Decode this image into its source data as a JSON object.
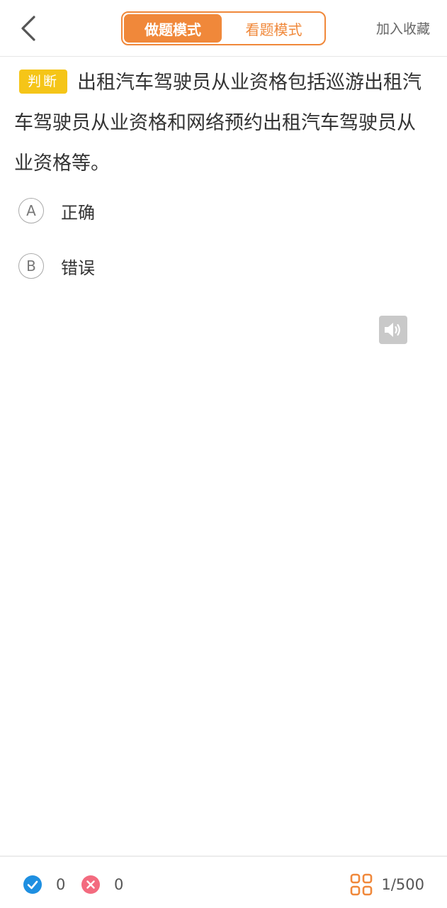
{
  "header": {
    "back_icon": "chevron-left-icon",
    "modes": [
      {
        "label": "做题模式",
        "active": true
      },
      {
        "label": "看题模式",
        "active": false
      }
    ],
    "favorite_label": "加入收藏"
  },
  "question": {
    "type_badge": "判断",
    "text": "出租汽车驾驶员从业资格包括巡游出租汽车驾驶员从业资格和网络预约出租汽车驾驶员从业资格等。",
    "options": [
      {
        "letter": "A",
        "text": "正确"
      },
      {
        "letter": "B",
        "text": "错误"
      }
    ]
  },
  "speaker_icon": "speaker-icon",
  "footer": {
    "correct_count": "0",
    "wrong_count": "0",
    "progress": "1/500"
  },
  "colors": {
    "accent": "#f0883a",
    "badge": "#f5c518",
    "correct": "#1e8fe1",
    "wrong": "#f36b7f"
  }
}
